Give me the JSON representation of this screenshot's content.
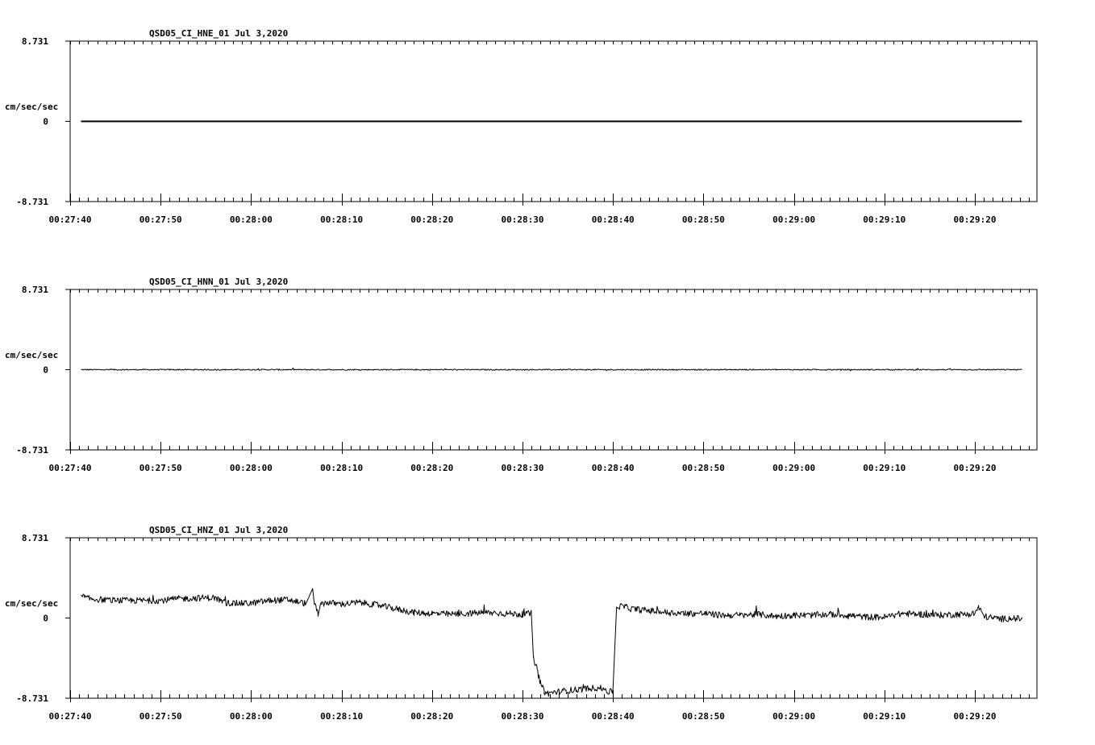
{
  "chart_data": [
    {
      "type": "line",
      "title": "QSD05_CI_HNE_01  Jul 3,2020",
      "ylabel": "cm/sec/sec",
      "ylim": [
        -8.731,
        8.731
      ],
      "y_ticks": [
        "8.731",
        "0",
        "-8.731"
      ],
      "x_ticks": [
        "00:27:40",
        "00:27:50",
        "00:28:00",
        "00:28:10",
        "00:28:20",
        "00:28:30",
        "00:28:40",
        "00:28:50",
        "00:29:00",
        "00:29:10",
        "00:29:20"
      ],
      "xlim_seconds": [
        0,
        106.9
      ],
      "series": [
        {
          "values_seconds": [
            1.2,
            105.2
          ],
          "values": [
            0.0,
            0.0
          ]
        }
      ]
    },
    {
      "type": "line",
      "title": "QSD05_CI_HNN_01  Jul 3,2020",
      "ylabel": "cm/sec/sec",
      "ylim": [
        -8.731,
        8.731
      ],
      "y_ticks": [
        "8.731",
        "0",
        "-8.731"
      ],
      "x_ticks": [
        "00:27:40",
        "00:27:50",
        "00:28:00",
        "00:28:10",
        "00:28:20",
        "00:28:30",
        "00:28:40",
        "00:28:50",
        "00:29:00",
        "00:29:10",
        "00:29:20"
      ],
      "xlim_seconds": [
        0,
        106.9
      ],
      "series": [
        {
          "values_seconds": [
            1.2,
            105.2
          ],
          "values": [
            0.0,
            0.0
          ],
          "noise": 0.06
        }
      ]
    },
    {
      "type": "line",
      "title": "QSD05_CI_HNZ_01  Jul 3,2020",
      "ylabel": "cm/sec/sec",
      "ylim": [
        -8.731,
        8.731
      ],
      "y_ticks": [
        "8.731",
        "0",
        "-8.731"
      ],
      "x_ticks": [
        "00:27:40",
        "00:27:50",
        "00:28:00",
        "00:28:10",
        "00:28:20",
        "00:28:30",
        "00:28:40",
        "00:28:50",
        "00:29:00",
        "00:29:10",
        "00:29:20"
      ],
      "xlim_seconds": [
        0,
        106.9
      ],
      "series": [
        {
          "values_seconds": [
            1.2,
            2.0,
            5.0,
            10.0,
            12.0,
            15.0,
            16.0,
            17.0,
            18.0,
            20.0,
            22.0,
            24.0,
            26.0,
            26.8,
            27.0,
            27.4,
            27.8,
            28.4,
            30.0,
            32.0,
            34.0,
            36.0,
            38.0,
            40.0,
            42.0,
            44.0,
            46.0,
            48.0,
            50.0,
            51.0,
            51.2,
            51.6,
            52.0,
            52.4,
            52.8,
            54.0,
            56.0,
            58.0,
            59.0,
            59.6,
            60.0,
            60.4,
            61.0,
            62.0,
            64.0,
            66.0,
            68.0,
            70.0,
            72.0,
            74.0,
            76.0,
            78.0,
            80.0,
            82.0,
            84.0,
            86.0,
            88.0,
            90.0,
            92.0,
            94.0,
            96.0,
            98.0,
            99.0,
            100.0,
            100.4,
            101.0,
            102.0,
            103.0,
            104.0,
            105.2
          ],
          "values": [
            2.4,
            2.1,
            1.9,
            1.9,
            2.1,
            2.2,
            2.2,
            1.7,
            1.6,
            1.6,
            1.9,
            2.0,
            1.6,
            3.2,
            1.5,
            0.5,
            1.5,
            1.7,
            1.5,
            1.7,
            1.4,
            1.0,
            0.6,
            0.5,
            0.4,
            0.5,
            0.6,
            0.5,
            0.4,
            0.5,
            -4.3,
            -5.6,
            -7.1,
            -8.0,
            -8.2,
            -8.0,
            -7.8,
            -7.6,
            -7.7,
            -8.1,
            -7.9,
            1.2,
            1.3,
            1.0,
            0.8,
            0.6,
            0.5,
            0.5,
            0.3,
            0.3,
            0.4,
            0.2,
            0.3,
            0.3,
            0.4,
            0.3,
            0.1,
            0.1,
            0.5,
            0.4,
            0.3,
            0.4,
            0.4,
            0.5,
            1.2,
            0.2,
            0.0,
            -0.1,
            0.0,
            -0.1
          ],
          "noise": 0.35
        }
      ]
    }
  ]
}
